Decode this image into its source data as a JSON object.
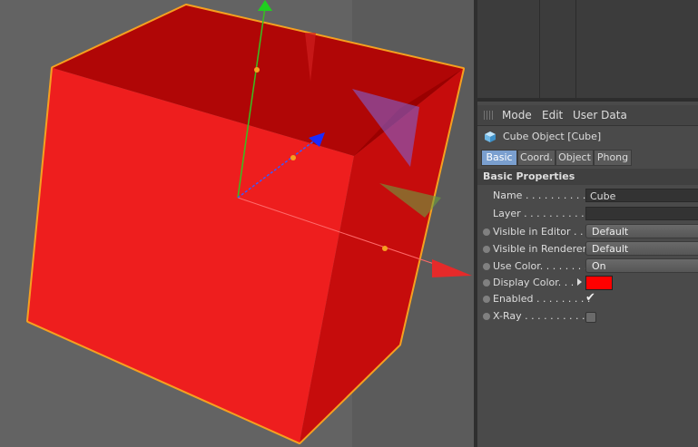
{
  "viewport": {
    "object_color": "#ec1d1d",
    "outline_color": "#f5a020"
  },
  "attr_menu": {
    "mode": "Mode",
    "edit": "Edit",
    "user_data": "User Data"
  },
  "object_title": "Cube Object [Cube]",
  "tabs": [
    "Basic",
    "Coord.",
    "Object",
    "Phong"
  ],
  "active_tab": "Basic",
  "section_title": "Basic Properties",
  "properties": {
    "name": {
      "label": "Name . . . . . . . . . . .",
      "value": "Cube"
    },
    "layer": {
      "label": "Layer . . . . . . . . . . .",
      "value": ""
    },
    "visible_editor": {
      "label": "Visible in Editor . .",
      "value": "Default"
    },
    "visible_renderer": {
      "label": "Visible in Renderer",
      "value": "Default"
    },
    "use_color": {
      "label": "Use Color. . . . . . . .",
      "value": "On"
    },
    "display_color": {
      "label": "Display Color. . .",
      "value": "#ff0000"
    },
    "enabled": {
      "label": "Enabled . . . . . . . . .",
      "value": "✔"
    },
    "xray": {
      "label": "X-Ray . . . . . . . . . . .",
      "checked": false
    }
  }
}
